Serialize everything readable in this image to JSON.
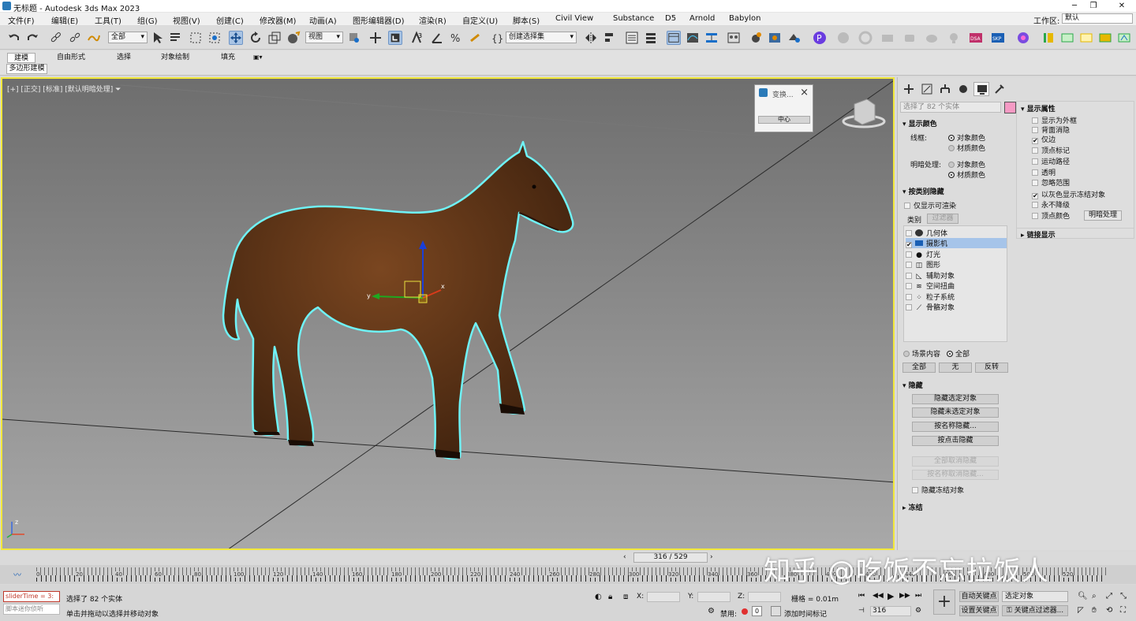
{
  "window": {
    "title": "无标题 - Autodesk 3ds Max 2023"
  },
  "menu": [
    "文件(F)",
    "编辑(E)",
    "工具(T)",
    "组(G)",
    "视图(V)",
    "创建(C)",
    "修改器(M)",
    "动画(A)",
    "图形编辑器(D)",
    "渲染(R)",
    "自定义(U)",
    "脚本(S)",
    "Civil View",
    "Substance",
    "D5",
    "Arnold",
    "Babylon"
  ],
  "workspace": {
    "label": "工作区:",
    "value": "默认"
  },
  "toolbar": {
    "filter_value": "全部",
    "refcoord_value": "视图",
    "selset_value": "创建选择集"
  },
  "ribbon": {
    "tabs": [
      "建模",
      "自由形式",
      "选择",
      "对象绘制",
      "填充"
    ],
    "sub": "多边形建模"
  },
  "viewport": {
    "label": "[+] [正交] [标准] [默认明暗处理]",
    "popup_title": "变换...",
    "popup_button": "中心"
  },
  "cmdpanel": {
    "selection": "选择了 82 个实体",
    "display_color": {
      "header": "显示颜色",
      "wire_label": "线框:",
      "shade_label": "明暗处理:",
      "opt1": "对象颜色",
      "opt2": "材质颜色"
    },
    "hide_by_category": {
      "header": "按类别隐藏",
      "renderable_only": "仅显示可渲染",
      "tab_category": "类别",
      "tab_filter": "过滤器",
      "items": [
        "几何体",
        "摄影机",
        "灯光",
        "图形",
        "辅助对象",
        "空间扭曲",
        "粒子系统",
        "骨骼对象"
      ],
      "scene": "场景内容",
      "all": "全部",
      "btn_all": "全部",
      "btn_none": "无",
      "btn_invert": "反转"
    },
    "hide": {
      "header": "隐藏",
      "buttons": [
        "隐藏选定对象",
        "隐藏未选定对象",
        "按名称隐藏...",
        "按点击隐藏"
      ],
      "disabled": [
        "全部取消隐藏",
        "按名称取消隐藏..."
      ],
      "frozen": "隐藏冻结对象"
    },
    "freeze": {
      "header": "冻结"
    },
    "display_props": {
      "header": "显示属性",
      "items": [
        "显示为外框",
        "背面消隐",
        "仅边",
        "顶点标记",
        "运动路径",
        "透明",
        "忽略范围",
        "以灰色显示冻结对象",
        "永不降级",
        "顶点颜色"
      ],
      "shade_button": "明暗处理"
    },
    "link_display": {
      "header": "链接显示"
    }
  },
  "timeslider": {
    "value": "316 / 529"
  },
  "trackbar": {
    "ticks": [
      "0",
      "20",
      "40",
      "60",
      "80",
      "100",
      "120",
      "140",
      "160",
      "180",
      "200",
      "220",
      "240",
      "260",
      "280",
      "300",
      "320",
      "340",
      "360",
      "380",
      "400",
      "420",
      "440",
      "460",
      "480",
      "500",
      "520"
    ]
  },
  "watermark": "知乎 @吃饭不忘拉饭人",
  "status": {
    "maxscript": "sliderTime = 3:",
    "listener": "脚本迷你侦听",
    "sel_msg": "选择了 82 个实体",
    "prompt": "单击并拖动以选择并移动对象",
    "x_label": "X:",
    "y_label": "Y:",
    "z_label": "Z:",
    "grid": "栅格 = 0.01m",
    "disable": "禁用:",
    "addtime": "添加时间标记",
    "autokey": "自动关键点",
    "setkey": "设置关键点",
    "selobj": "选定对象",
    "keyfilter": "关键点过滤器...",
    "frame": "316"
  }
}
